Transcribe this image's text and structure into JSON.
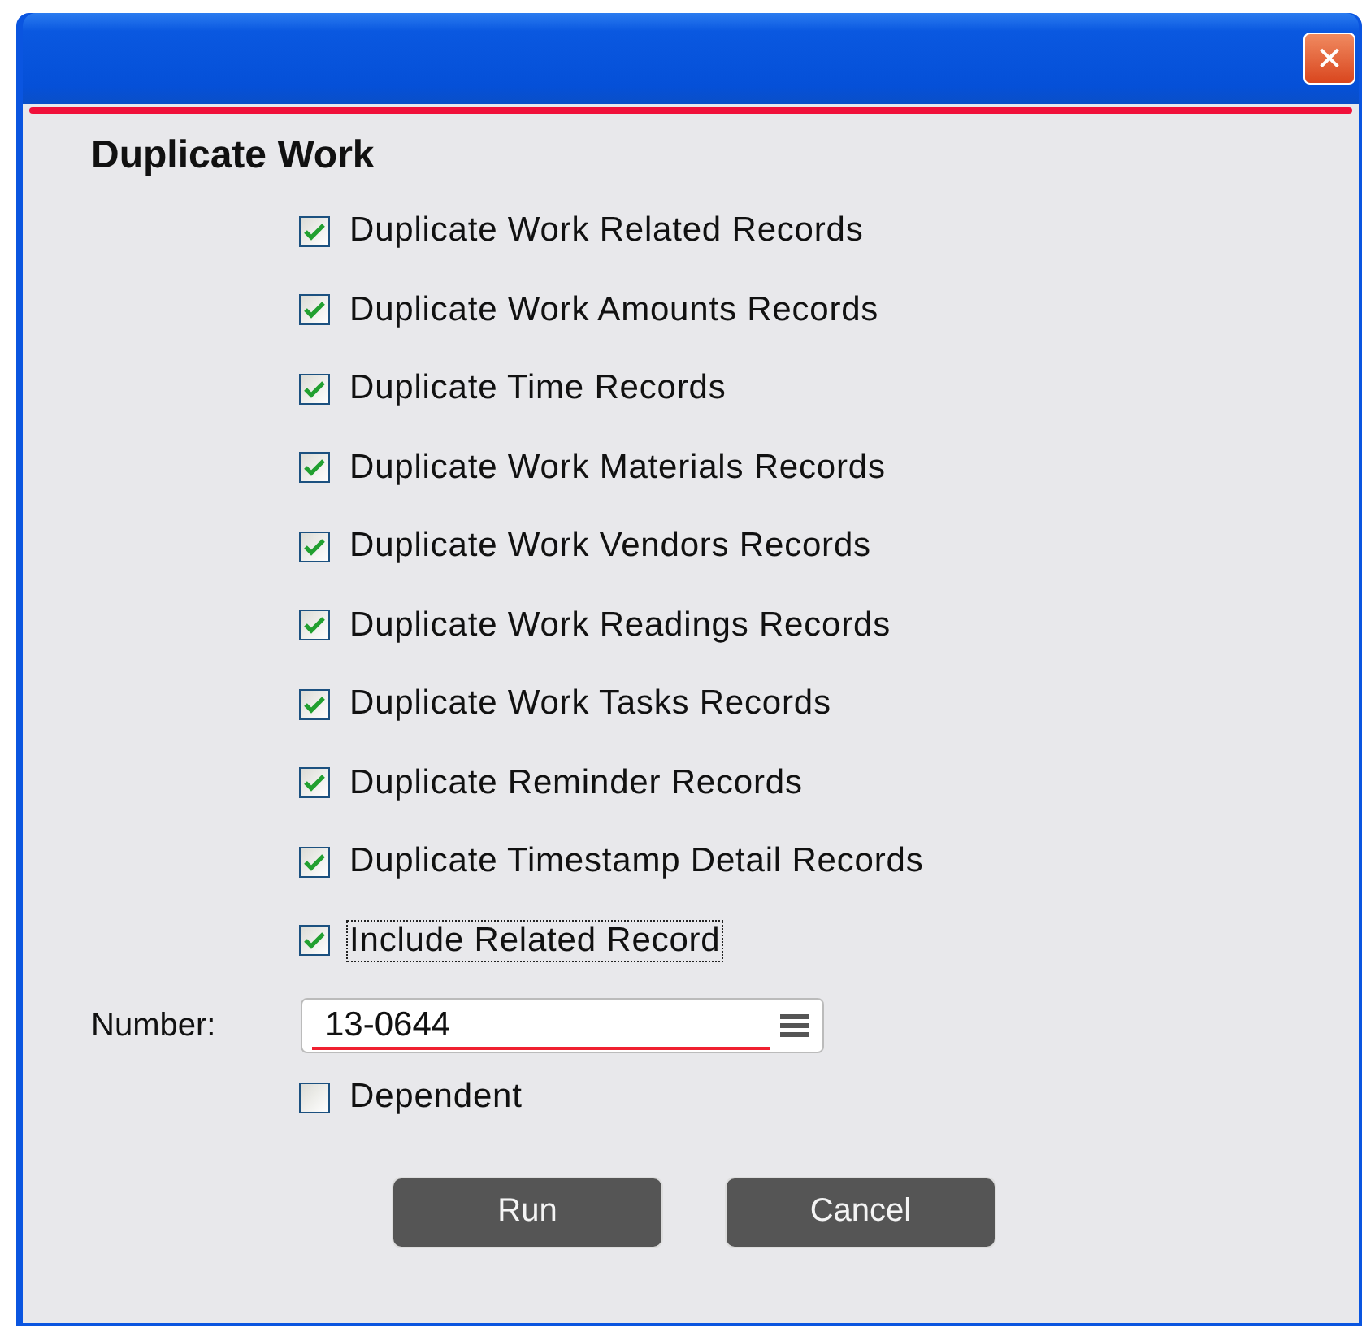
{
  "window": {
    "close_label": "✕"
  },
  "title": "Duplicate Work",
  "options": [
    {
      "label": "Duplicate Work Related Records",
      "checked": true,
      "focused": false
    },
    {
      "label": "Duplicate Work Amounts Records",
      "checked": true,
      "focused": false
    },
    {
      "label": "Duplicate Time Records",
      "checked": true,
      "focused": false
    },
    {
      "label": "Duplicate Work Materials Records",
      "checked": true,
      "focused": false
    },
    {
      "label": "Duplicate Work Vendors Records",
      "checked": true,
      "focused": false
    },
    {
      "label": "Duplicate Work Readings Records",
      "checked": true,
      "focused": false
    },
    {
      "label": "Duplicate Work Tasks Records",
      "checked": true,
      "focused": false
    },
    {
      "label": "Duplicate Reminder Records",
      "checked": true,
      "focused": false
    },
    {
      "label": "Duplicate Timestamp Detail Records",
      "checked": true,
      "focused": false
    },
    {
      "label": "Include Related Record",
      "checked": true,
      "focused": true
    }
  ],
  "number": {
    "label": "Number:",
    "value": "13-0644"
  },
  "dependent": {
    "label": "Dependent",
    "checked": false
  },
  "buttons": [
    "Run",
    "Cancel"
  ]
}
